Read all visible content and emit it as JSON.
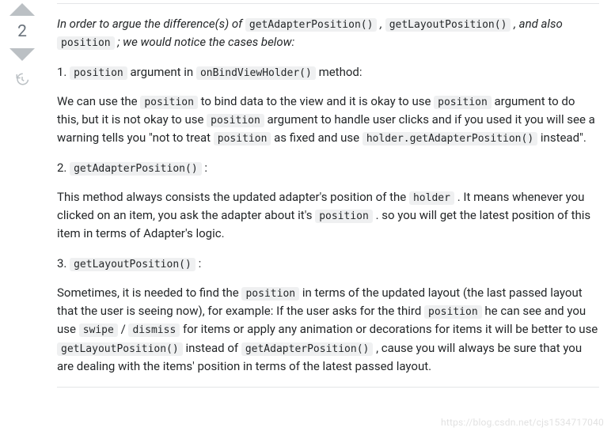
{
  "vote": {
    "score": "2"
  },
  "post": {
    "lead_1": "In order to argue the difference(s) of ",
    "lead_c1": "getAdapterPosition()",
    "lead_2": " , ",
    "lead_c2": "getLayoutPosition()",
    "lead_3": " , and also ",
    "lead_c3": "position",
    "lead_4": " ; we would notice the cases below:",
    "p1_1": "1. ",
    "p1_c1": "position",
    "p1_2": " argument in ",
    "p1_c2": "onBindViewHolder()",
    "p1_3": " method:",
    "p2_1": "We can use the ",
    "p2_c1": "position",
    "p2_2": " to bind data to the view and it is okay to use ",
    "p2_c2": "position",
    "p2_3": " argument to do this, but it is not okay to use ",
    "p2_c3": "position",
    "p2_4": " argument to handle user clicks and if you used it you will see a warning tells you \"not to treat ",
    "p2_c4": "position",
    "p2_5": " as fixed and use ",
    "p2_c5": "holder.getAdapterPosition()",
    "p2_6": " instead\".",
    "p3_1": "2. ",
    "p3_c1": "getAdapterPosition()",
    "p3_2": " :",
    "p4_1": "This method always consists the updated adapter's position of the ",
    "p4_c1": "holder",
    "p4_2": " . It means whenever you clicked on an item, you ask the adapter about it's ",
    "p4_c2": "position",
    "p4_3": " . so you will get the latest position of this item in terms of Adapter's logic.",
    "p5_1": "3. ",
    "p5_c1": "getLayoutPosition()",
    "p5_2": " :",
    "p6_1": "Sometimes, it is needed to find the ",
    "p6_c1": "position",
    "p6_2": " in terms of the updated layout (the last passed layout that the user is seeing now), for example: If the user asks for the third ",
    "p6_c2": "position",
    "p6_3": " he can see and you use ",
    "p6_c3": "swipe",
    "p6_4": " / ",
    "p6_c4": "dismiss",
    "p6_5": " for items or apply any animation or decorations for items it will be better to use ",
    "p6_c5": "getLayoutPosition()",
    "p6_6": " instead of ",
    "p6_c6": "getAdapterPosition()",
    "p6_7": " , cause you will always be sure that you are dealing with the items' position in terms of the latest passed layout."
  },
  "watermark": "https://blog.csdn.net/cjs1534717040"
}
